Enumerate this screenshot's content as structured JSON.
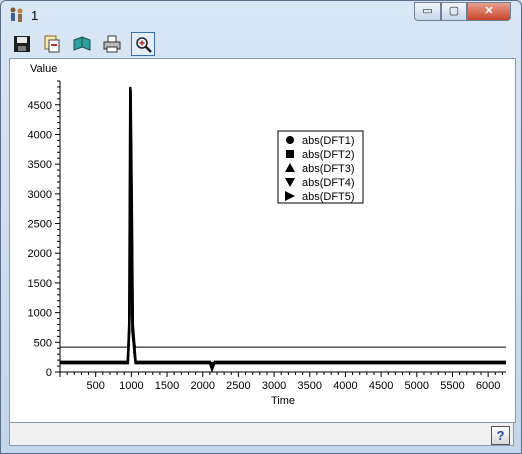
{
  "window": {
    "title": "1",
    "minimize_symbol": "▭",
    "maximize_symbol": "▢",
    "close_symbol": "✕"
  },
  "toolbar": {
    "buttons": [
      {
        "icon": "save-icon"
      },
      {
        "icon": "copy-icon"
      },
      {
        "icon": "open-book-icon"
      },
      {
        "icon": "print-icon"
      },
      {
        "icon": "zoom-icon",
        "active": true
      }
    ]
  },
  "statusbar": {
    "help_label": "?"
  },
  "chart_data": {
    "type": "line",
    "ylabel": "Value",
    "xlabel": "Time",
    "xlim": [
      0,
      6250
    ],
    "ylim": [
      0,
      4900
    ],
    "x_ticks": [
      "500",
      "1000",
      "1500",
      "2000",
      "2500",
      "3000",
      "3500",
      "4000",
      "4500",
      "5000",
      "5500",
      "6000"
    ],
    "y_ticks": [
      "0",
      "500",
      "1000",
      "1500",
      "2000",
      "2500",
      "3000",
      "3500",
      "4000",
      "4500"
    ],
    "legend_position": "top-right",
    "series": [
      {
        "name": "abs(DFT1)",
        "marker": "circle",
        "points": [
          [
            0,
            150
          ],
          [
            950,
            150
          ],
          [
            970,
            700
          ],
          [
            985,
            4800
          ],
          [
            1000,
            2900
          ],
          [
            1015,
            700
          ],
          [
            1060,
            150
          ],
          [
            2100,
            150
          ],
          [
            2130,
            50
          ],
          [
            2160,
            150
          ],
          [
            6250,
            150
          ]
        ]
      },
      {
        "name": "abs(DFT2)",
        "marker": "square",
        "points": [
          [
            0,
            170
          ],
          [
            950,
            170
          ],
          [
            975,
            950
          ],
          [
            990,
            4750
          ],
          [
            1005,
            3000
          ],
          [
            1020,
            800
          ],
          [
            1060,
            170
          ],
          [
            2100,
            170
          ],
          [
            2140,
            80
          ],
          [
            2170,
            170
          ],
          [
            6250,
            170
          ]
        ]
      },
      {
        "name": "abs(DFT3)",
        "marker": "triangle-up",
        "points": [
          [
            0,
            420
          ],
          [
            950,
            420
          ],
          [
            980,
            900
          ],
          [
            995,
            4700
          ],
          [
            1010,
            3100
          ],
          [
            1030,
            600
          ],
          [
            1060,
            420
          ],
          [
            6250,
            420
          ]
        ]
      },
      {
        "name": "abs(DFT4)",
        "marker": "triangle-down",
        "points": [
          [
            0,
            160
          ],
          [
            950,
            160
          ],
          [
            970,
            500
          ],
          [
            990,
            3000
          ],
          [
            1005,
            2900
          ],
          [
            1025,
            500
          ],
          [
            1060,
            160
          ],
          [
            6250,
            160
          ]
        ]
      },
      {
        "name": "abs(DFT5)",
        "marker": "triangle-right",
        "points": [
          [
            0,
            155
          ],
          [
            950,
            155
          ],
          [
            972,
            400
          ],
          [
            992,
            2000
          ],
          [
            1008,
            1900
          ],
          [
            1030,
            300
          ],
          [
            1060,
            155
          ],
          [
            6250,
            155
          ]
        ]
      }
    ]
  }
}
